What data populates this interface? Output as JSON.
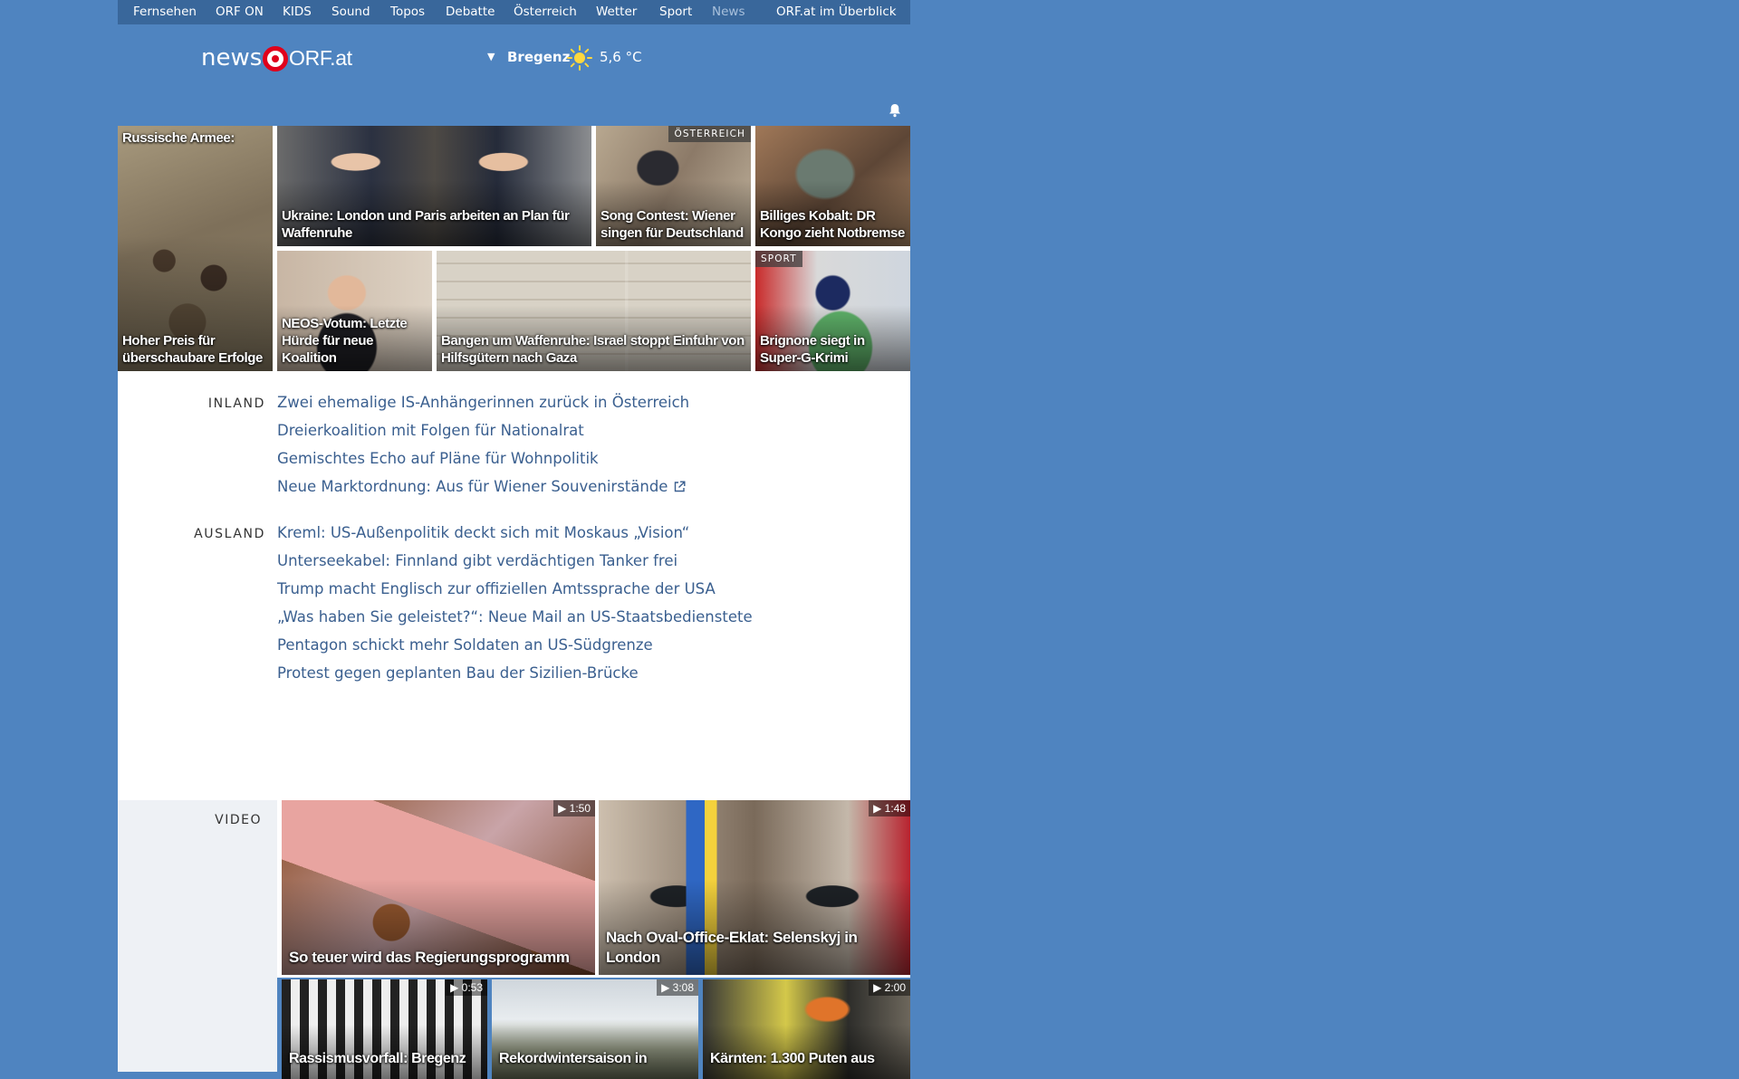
{
  "topnav": {
    "items": [
      "Fernsehen",
      "ORF ON",
      "KIDS",
      "Sound",
      "Topos",
      "Debatte",
      "Österreich",
      "Wetter",
      "Sport",
      "News"
    ],
    "overview": "ORF.at im Überblick"
  },
  "logo": {
    "news": "news",
    "orf": "ORF.at"
  },
  "weather": {
    "city": "Bregenz",
    "temp": "5,6 °C",
    "icon": "sun-icon"
  },
  "tiles": [
    {
      "caption": "Russische Armee:",
      "caption2": "Hoher Preis für überschaubare Erfolge"
    },
    {
      "caption": "Ukraine: London und Paris arbeiten an Plan für Waffenruhe"
    },
    {
      "tag": "ÖSTERREICH",
      "caption": "Song Contest: Wiener singen für Deutschland"
    },
    {
      "caption": "Billiges Kobalt: DR Kongo zieht Notbremse"
    },
    {
      "caption": "NEOS-Votum: Letzte Hürde für neue Koalition"
    },
    {
      "caption": "Bangen um Waffenruhe: Israel stoppt Einfuhr von Hilfsgütern nach Gaza"
    },
    {
      "tag": "SPORT",
      "caption": "Brignone siegt in Super-G-Krimi"
    }
  ],
  "inland": {
    "label": "INLAND",
    "items": [
      "Zwei ehemalige IS-Anhängerinnen zurück in Österreich",
      "Dreierkoalition mit Folgen für Nationalrat",
      "Gemischtes Echo auf Pläne für Wohnpolitik",
      "Neue Marktordnung: Aus für Wiener Souvenirstände"
    ]
  },
  "ausland": {
    "label": "AUSLAND",
    "items": [
      "Kreml: US-Außenpolitik deckt sich mit Moskaus „Vision“",
      "Unterseekabel: Finnland gibt verdächtigen Tanker frei",
      "Trump macht Englisch zur offiziellen Amtssprache der USA",
      "„Was haben Sie geleistet?“: Neue Mail an US-Staatsbedienstete",
      "Pentagon schickt mehr Soldaten an US-Südgrenze",
      "Protest gegen geplanten Bau der Sizilien-Brücke"
    ]
  },
  "video": {
    "label": "VIDEO",
    "items": [
      {
        "caption": "So teuer wird das Regierungsprogramm",
        "duration": "1:50"
      },
      {
        "caption": "Nach Oval-Office-Eklat: Selenskyj in London",
        "duration": "1:48"
      },
      {
        "caption": "Rassismusvorfall: Bregenz",
        "duration": "0:53"
      },
      {
        "caption": "Rekordwintersaison in",
        "duration": "3:08"
      },
      {
        "caption": "Kärnten: 1.300 Puten aus",
        "duration": "2:00"
      }
    ]
  }
}
